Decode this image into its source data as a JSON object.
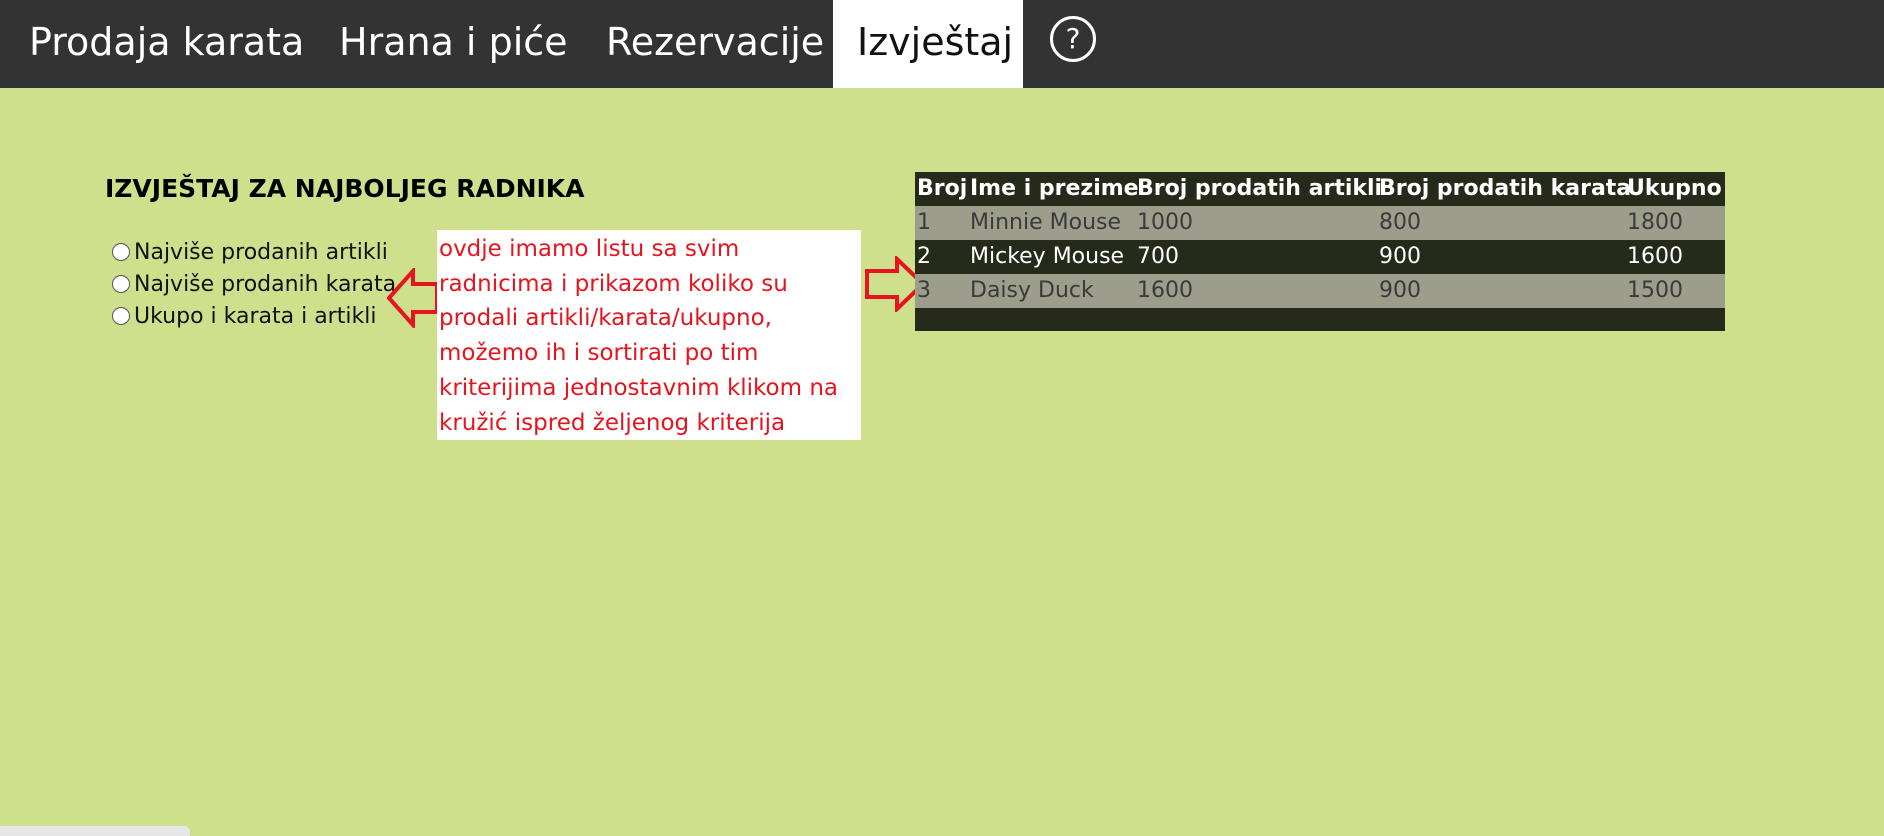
{
  "tabs": [
    {
      "label": "Prodaja karata",
      "active": false
    },
    {
      "label": "Hrana i piće",
      "active": false
    },
    {
      "label": "Rezervacije",
      "active": false
    },
    {
      "label": "Izvještaj",
      "active": true
    }
  ],
  "help_label": "?",
  "report": {
    "title": "IZVJEŠTAJ ZA NAJBOLJEG RADNIKA",
    "sort_options": [
      {
        "label": "Najviše prodanih artikli",
        "selected": false
      },
      {
        "label": "Najviše prodanih karata",
        "selected": false
      },
      {
        "label": "Ukupo i karata i artikli",
        "selected": false
      }
    ]
  },
  "annotation": {
    "text": "ovdje imamo listu sa svim radnicima i prikazom koliko su prodali artikli/karata/ukupno, možemo ih i sortirati po tim kriterijima jednostavnim klikom na kružić ispred željenog kriterija",
    "color": "#e6141e"
  },
  "table": {
    "headers": [
      "Broj",
      "Ime i prezime",
      "Broj prodatih artikli",
      "Broj prodatih karata",
      "Ukupno"
    ],
    "rows": [
      [
        "1",
        "Minnie Mouse",
        "1000",
        "800",
        "1800"
      ],
      [
        "2",
        "Mickey Mouse",
        "700",
        "900",
        "1600"
      ],
      [
        "3",
        "Daisy Duck",
        "1600",
        "900",
        "1500"
      ]
    ]
  },
  "colors": {
    "background": "#cfe08d",
    "navbar": "#333333",
    "table_dark": "#262a1a",
    "table_light": "#9c9e8b"
  }
}
